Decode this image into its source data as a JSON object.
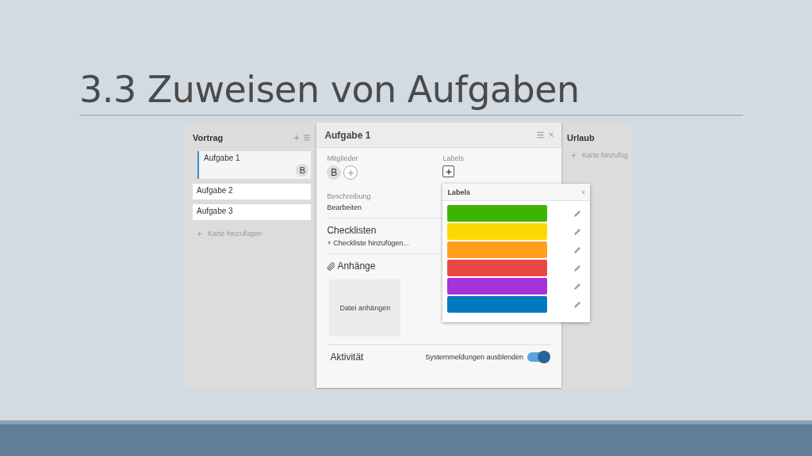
{
  "slide": {
    "title": "3.3 Zuweisen von Aufgaben"
  },
  "left_list": {
    "title": "Vortrag",
    "cards": [
      {
        "title": "Aufgabe 1",
        "selected": true,
        "member": "B"
      },
      {
        "title": "Aufgabe 2",
        "selected": false
      },
      {
        "title": "Aufgabe 3",
        "selected": false
      }
    ],
    "add_card": "Karte hinzufügen"
  },
  "card_detail": {
    "title": "Aufgabe 1",
    "members_label": "Mitglieder",
    "members": [
      "B"
    ],
    "labels_label": "Labels",
    "description_label": "Beschreibung",
    "description_action": "Bearbeiten",
    "checklists_title": "Checklisten",
    "checklist_add": "+ Checkliste hinzufügen...",
    "attachments_title": "Anhänge",
    "attach_button": "Datei anhängen",
    "activity_title": "Aktivität",
    "system_toggle": {
      "label": "Systemmeldungen ausblenden",
      "on": true
    }
  },
  "labels_popup": {
    "title": "Labels",
    "close": "×",
    "labels": [
      {
        "color": "#3cb500"
      },
      {
        "color": "#fad900"
      },
      {
        "color": "#ff9f1a"
      },
      {
        "color": "#eb4646"
      },
      {
        "color": "#a632db"
      },
      {
        "color": "#0079bf"
      }
    ]
  },
  "right_list": {
    "title": "Urlaub",
    "add_card": "Karte hinzufüg"
  }
}
